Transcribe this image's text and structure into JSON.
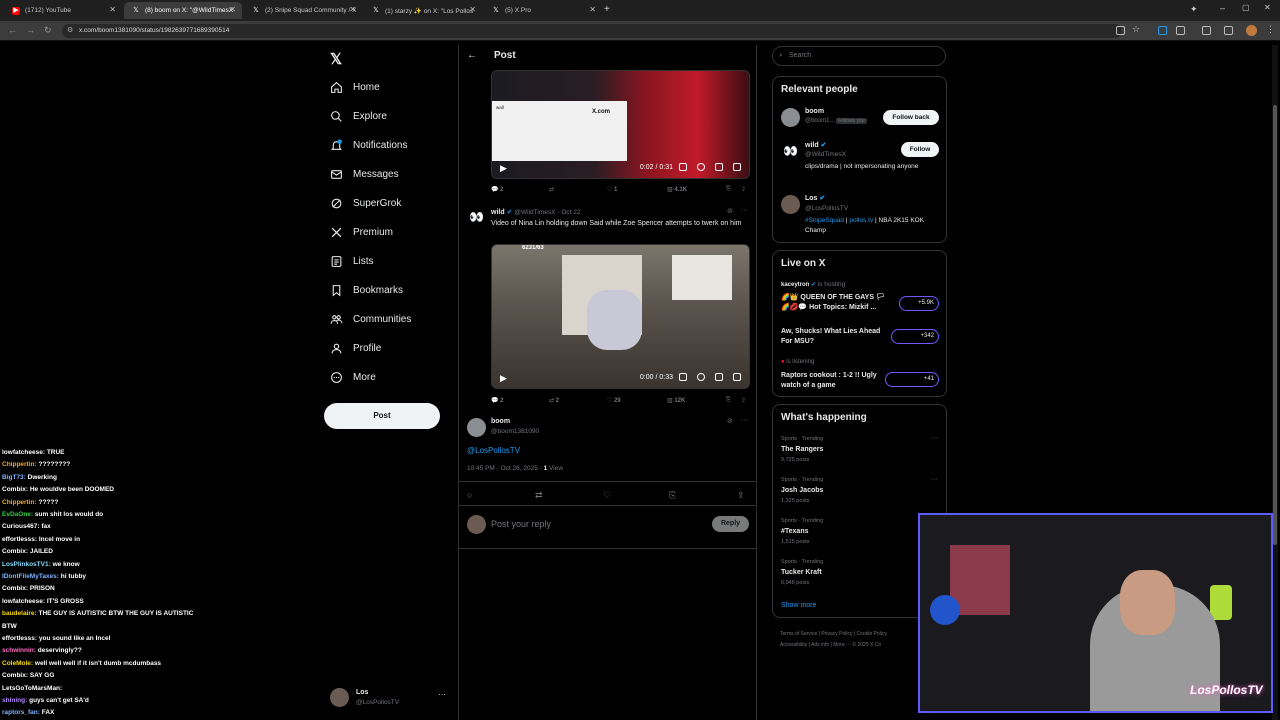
{
  "browser": {
    "tabs": [
      {
        "title": "(1712) YouTube",
        "favicon": "youtube-icon",
        "color": "#ff0000",
        "active": false
      },
      {
        "title": "(8) boom on X: \"@WildTimesX",
        "favicon": "x-icon",
        "color": "#ffffff",
        "active": true
      },
      {
        "title": "(2) Snipe Squad Community / X",
        "favicon": "x-icon",
        "color": "#ffffff",
        "active": false
      },
      {
        "title": "(1) starzy ✨ on X: \"Los Pollos",
        "favicon": "x-icon",
        "color": "#ffffff",
        "active": false
      },
      {
        "title": "(5) X Pro",
        "favicon": "x-icon",
        "color": "#ffffff",
        "active": false
      }
    ],
    "url": "x.com/boom1381090/status/1982639771689390514"
  },
  "nav": {
    "items": [
      {
        "label": "Home",
        "icon": "home-icon"
      },
      {
        "label": "Explore",
        "icon": "search-icon"
      },
      {
        "label": "Notifications",
        "icon": "bell-icon"
      },
      {
        "label": "Messages",
        "icon": "mail-icon"
      },
      {
        "label": "SuperGrok",
        "icon": "grok-icon"
      },
      {
        "label": "Premium",
        "icon": "x-icon"
      },
      {
        "label": "Lists",
        "icon": "list-icon"
      },
      {
        "label": "Bookmarks",
        "icon": "bookmark-icon"
      },
      {
        "label": "Communities",
        "icon": "people-icon"
      },
      {
        "label": "Profile",
        "icon": "person-icon"
      },
      {
        "label": "More",
        "icon": "more-circle-icon"
      }
    ],
    "post_label": "Post",
    "account": {
      "name": "Los",
      "handle": "@LosPollosTV"
    }
  },
  "main": {
    "header_title": "Post",
    "video1": {
      "time": "0:02 / 0:31",
      "overlay_brand": "X.com",
      "overlay_user": "wall"
    },
    "actions1": {
      "replies": "2",
      "likes": "1",
      "views": "4.1K"
    },
    "quoted": {
      "name": "wild",
      "handle": "@WildTimesX",
      "date": "· Oct 22",
      "text": "Video of Nina Lin holding down Said while Zoe Spencer attempts to twerk on him",
      "video_time": "0:00 / 0:33",
      "video_overlay": "6231/63"
    },
    "actions2": {
      "replies": "2",
      "reposts": "2",
      "likes": "29",
      "views": "12K"
    },
    "reply": {
      "name": "boom",
      "handle": "@boom1381090",
      "mention": "@LosPollosTV",
      "time": "10:45 PM · Oct 26, 2025 ·",
      "views": "1",
      "views_label": "View"
    },
    "composer_placeholder": "Post your reply",
    "reply_btn": "Reply"
  },
  "sidebar": {
    "search_placeholder": "Search",
    "relevant_title": "Relevant people",
    "people": [
      {
        "name": "boom",
        "handle": "@boom1...",
        "badge": "Follows you",
        "button": "Follow back",
        "bio": ""
      },
      {
        "name": "wild",
        "handle": "@WildTimesX",
        "button": "Follow",
        "bio": "clips/drama | not impersonating anyone"
      },
      {
        "name": "Los",
        "handle": "@LosPollosTV",
        "bio_tag": "#SnipeSquad",
        "bio_link": "pollos.tv",
        "bio_rest": "| NBA 2K15 KOK Champ",
        "bio_pipe": "|"
      }
    ],
    "live_title": "Live on X",
    "live": [
      {
        "host": "kaceytron",
        "status": "is hosting",
        "title": "🌈👑 QUEEN OF THE GAYS 🏳 🌈💋💬 Hot Topics: Mizkif ...",
        "count": "+5.9K"
      },
      {
        "host": "",
        "status": "",
        "title": "Aw, Shucks! What Lies Ahead For MSU?",
        "count": "+342"
      },
      {
        "host": "",
        "status": "is listening",
        "title": "Raptors cookout : 1-2 !! Ugly watch of a game",
        "count": "+41"
      }
    ],
    "happening_title": "What's happening",
    "trends": [
      {
        "category": "Sports · Trending",
        "name": "The Rangers",
        "posts": "9,725 posts"
      },
      {
        "category": "Sports · Trending",
        "name": "Josh Jacobs",
        "posts": "1,325 posts"
      },
      {
        "category": "Sports · Trending",
        "name": "#Texans",
        "posts": "1,515 posts"
      },
      {
        "category": "Sports · Trending",
        "name": "Tucker Kraft",
        "posts": "6,946 posts"
      }
    ],
    "show_more": "Show more",
    "footer": [
      "Terms of Service",
      "|",
      "Privacy Policy",
      "|",
      "Cookie Policy",
      "Accessibility",
      "|",
      "Ads info",
      "|",
      "More ···",
      "© 2025 X Co"
    ]
  },
  "chat": [
    {
      "user": "lowfatcheese",
      "color": "#ffffff",
      "msg": "TRUE"
    },
    {
      "user": "Chippertin",
      "color": "#f5a623",
      "msg": "????????"
    },
    {
      "user": "BigT73",
      "color": "#7fb2ff",
      "msg": "Dwerking"
    },
    {
      "user": "Combix",
      "color": "#ffffff",
      "msg": "He wouldve been DOOMED"
    },
    {
      "user": "Chippertin",
      "color": "#f5a623",
      "msg": "?????"
    },
    {
      "user": "EvDaOne",
      "color": "#2ecc40",
      "msg": "sum shit los would do"
    },
    {
      "user": "Curious467",
      "color": "#ffffff",
      "msg": "fax"
    },
    {
      "user": "effortlesss",
      "color": "#ffffff",
      "msg": "Incel move in"
    },
    {
      "user": "Combix",
      "color": "#ffffff",
      "msg": "JAILED"
    },
    {
      "user": "LosPlinkosTV1",
      "color": "#7fdbff",
      "msg": "we know"
    },
    {
      "user": "IDontFileMyTaxes",
      "color": "#7fb2ff",
      "msg": "hi tubby"
    },
    {
      "user": "Combix",
      "color": "#ffffff",
      "msg": "PRISON"
    },
    {
      "user": "lowfatcheese",
      "color": "#ffffff",
      "msg": "IT'S GROSS"
    },
    {
      "user": "baudelaire",
      "color": "#ffdc00",
      "msg": "THE GUY IS AUTISTIC BTW THE GUY IS AUTISTIC"
    },
    {
      "user": "",
      "color": "#ffffff",
      "msg": "BTW"
    },
    {
      "user": "effortlesss",
      "color": "#ffffff",
      "msg": "you sound like an Incel"
    },
    {
      "user": "schwinnin",
      "color": "#ff6ec7",
      "msg": "deservingly??"
    },
    {
      "user": "ColeMole",
      "color": "#ffdc00",
      "msg": "well well well if it isn't dumb mcdumbass"
    },
    {
      "user": "Combix",
      "color": "#ffffff",
      "msg": "SAY GG"
    },
    {
      "user": "LetsGoToMarsMan",
      "color": "#ffffff",
      "msg": ""
    },
    {
      "user": "shining",
      "color": "#b388ff",
      "msg": "guys can't get SA'd"
    },
    {
      "user": "raptors_fan",
      "color": "#7fb2ff",
      "msg": "FAX"
    }
  ],
  "webcam": {
    "logo_text": "LosPollosTV"
  },
  "colors": {
    "accent": "#1d9bf0",
    "border": "#2f3336",
    "muted": "#71767b"
  }
}
